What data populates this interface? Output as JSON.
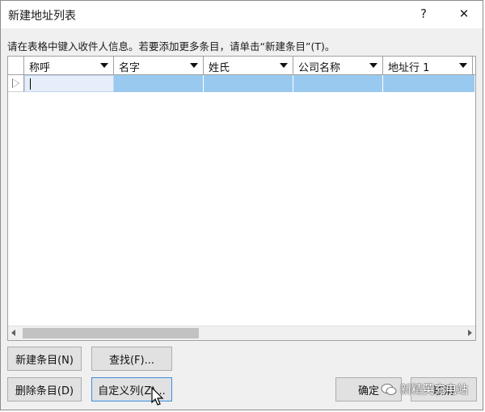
{
  "window": {
    "title": "新建地址列表",
    "help_label": "?",
    "close_label": "✕"
  },
  "instruction": "请在表格中键入收件人信息。若要添加更多条目，请单击“新建条目”(T)。",
  "grid": {
    "columns": [
      {
        "label": "称呼"
      },
      {
        "label": "名字"
      },
      {
        "label": "姓氏"
      },
      {
        "label": "公司名称"
      },
      {
        "label": "地址行 1"
      }
    ]
  },
  "buttons": {
    "new_entry": "新建条目(N)",
    "find": "查找(F)...",
    "delete_entry": "删除条目(D)",
    "customize_columns": "自定义列(Z)...",
    "ok": "确定",
    "cancel": "取消"
  },
  "watermark": {
    "text": "新精英充电站"
  }
}
